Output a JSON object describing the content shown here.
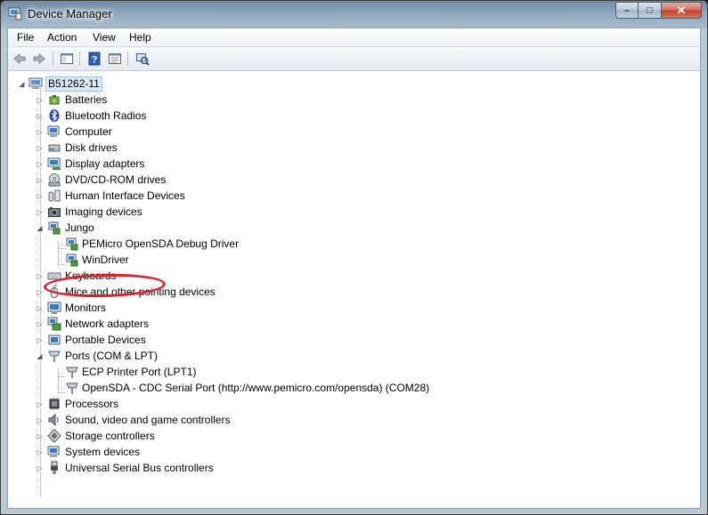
{
  "window": {
    "title": "Device Manager"
  },
  "caption_buttons": {
    "minimize": "–",
    "maximize": "□",
    "close": "✕"
  },
  "menu": [
    "File",
    "Action",
    "View",
    "Help"
  ],
  "toolbar": {
    "back": "back-arrow-icon",
    "forward": "forward-arrow-icon",
    "show_hide": "console-tree-icon",
    "help": "help-icon",
    "properties": "properties-icon",
    "scan": "scan-hardware-icon"
  },
  "tree": {
    "root": "B51262-11",
    "categories": [
      {
        "label": "Batteries"
      },
      {
        "label": "Bluetooth Radios"
      },
      {
        "label": "Computer"
      },
      {
        "label": "Disk drives"
      },
      {
        "label": "Display adapters"
      },
      {
        "label": "DVD/CD-ROM drives"
      },
      {
        "label": "Human Interface Devices"
      },
      {
        "label": "Imaging devices"
      },
      {
        "label": "Jungo",
        "children": [
          "PEMicro OpenSDA Debug Driver",
          "WinDriver"
        ]
      },
      {
        "label": "Keyboards"
      },
      {
        "label": "Mice and other pointing devices"
      },
      {
        "label": "Monitors"
      },
      {
        "label": "Network adapters"
      },
      {
        "label": "Portable Devices"
      },
      {
        "label": "Ports (COM & LPT)",
        "children": [
          "ECP Printer Port (LPT1)",
          "OpenSDA - CDC Serial Port (http://www.pemicro.com/opensda) (COM28)"
        ]
      },
      {
        "label": "Processors"
      },
      {
        "label": "Sound, video and game controllers"
      },
      {
        "label": "Storage controllers"
      },
      {
        "label": "System devices"
      },
      {
        "label": "Universal Serial Bus controllers"
      }
    ]
  },
  "colors": {
    "accent": "#e0202a",
    "selection": "#dce9f7"
  }
}
